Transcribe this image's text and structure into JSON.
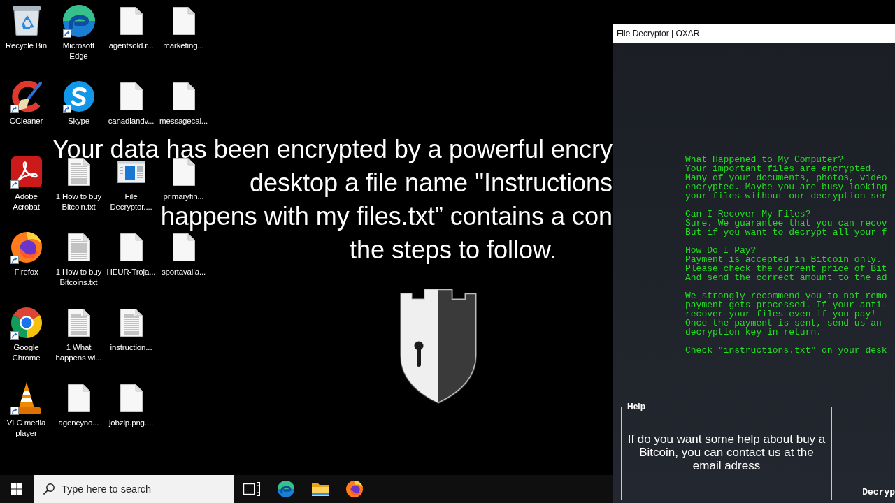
{
  "wallpaper": {
    "lines": [
      {
        "text": "Your data has been encrypted by a powerful encry",
        "cut": true
      },
      {
        "text": "desktop a file name \"Instructions",
        "cut": true
      },
      {
        "text": "happens with my files.txt” contains a con",
        "cut": true
      },
      {
        "text": "the steps to follow.",
        "cut": false
      }
    ]
  },
  "desktop": {
    "icons": [
      {
        "label": "Recycle Bin",
        "kind": "recycle-bin",
        "shortcut": false
      },
      {
        "label": "CCleaner",
        "kind": "ccleaner",
        "shortcut": true
      },
      {
        "label": "Adobe Acrobat",
        "kind": "acrobat",
        "shortcut": true
      },
      {
        "label": "Firefox",
        "kind": "firefox",
        "shortcut": true
      },
      {
        "label": "Google Chrome",
        "kind": "chrome",
        "shortcut": true
      },
      {
        "label": "VLC media player",
        "kind": "vlc",
        "shortcut": true
      },
      {
        "label": "Microsoft Edge",
        "kind": "edge",
        "shortcut": true
      },
      {
        "label": "Skype",
        "kind": "skype",
        "shortcut": true
      },
      {
        "label": "1 How to buy Bitcoin.txt",
        "kind": "text-file",
        "shortcut": false
      },
      {
        "label": "1 How to buy Bitcoins.txt",
        "kind": "text-file",
        "shortcut": false
      },
      {
        "label": "1 What happens wi...",
        "kind": "text-file",
        "shortcut": false
      },
      {
        "label": "agencyno...",
        "kind": "blank-file",
        "shortcut": false
      },
      {
        "label": "agentsold.r...",
        "kind": "blank-file",
        "shortcut": false
      },
      {
        "label": "canadiandv...",
        "kind": "blank-file",
        "shortcut": false
      },
      {
        "label": "File Decryptor....",
        "kind": "app-window",
        "shortcut": false
      },
      {
        "label": "HEUR-Troja...",
        "kind": "blank-file",
        "shortcut": false
      },
      {
        "label": "instruction...",
        "kind": "text-file",
        "shortcut": false
      },
      {
        "label": "jobzip.png....",
        "kind": "blank-file",
        "shortcut": false
      },
      {
        "label": "marketing...",
        "kind": "blank-file",
        "shortcut": false
      },
      {
        "label": "messagecal...",
        "kind": "blank-file",
        "shortcut": false
      },
      {
        "label": "primaryfin...",
        "kind": "blank-file",
        "shortcut": false
      },
      {
        "label": "sportavaila...",
        "kind": "blank-file",
        "shortcut": false
      }
    ]
  },
  "taskbar": {
    "search": {
      "placeholder": "Type here to search"
    },
    "apps": [
      {
        "kind": "task-view"
      },
      {
        "kind": "edge"
      },
      {
        "kind": "explorer"
      },
      {
        "kind": "firefox"
      }
    ]
  },
  "window": {
    "title": "File Decryptor | OXAR",
    "note": [
      {
        "heading": "What Happened to My Computer?",
        "lines": [
          "Your important files are encrypted.",
          "Many of your documents, photos, video",
          "encrypted. Maybe you are busy looking",
          "your files without our decryption ser"
        ]
      },
      {
        "heading": "Can I Recover My Files?",
        "lines": [
          "Sure. We guarantee that you can recov",
          "But if you want to decrypt all your f"
        ]
      },
      {
        "heading": "How Do I Pay?",
        "lines": [
          "Payment is accepted in Bitcoin only.",
          "Please check the current price of Bit",
          "And send the correct amount to the ad"
        ]
      },
      {
        "lines": [
          "We strongly recommend you to not remo",
          "payment gets processed. If your anti-",
          "recover your files even if you pay!",
          "Once the payment is sent, send us an",
          "decryption key in return."
        ]
      },
      {
        "lines": [
          "Check \"instructions.txt\" on your desk"
        ]
      }
    ],
    "help": {
      "title": "Help",
      "text": "If do you want some help about buy a Bitcoin, you can contact us at the email adress"
    },
    "footer_text": "Decryp"
  }
}
